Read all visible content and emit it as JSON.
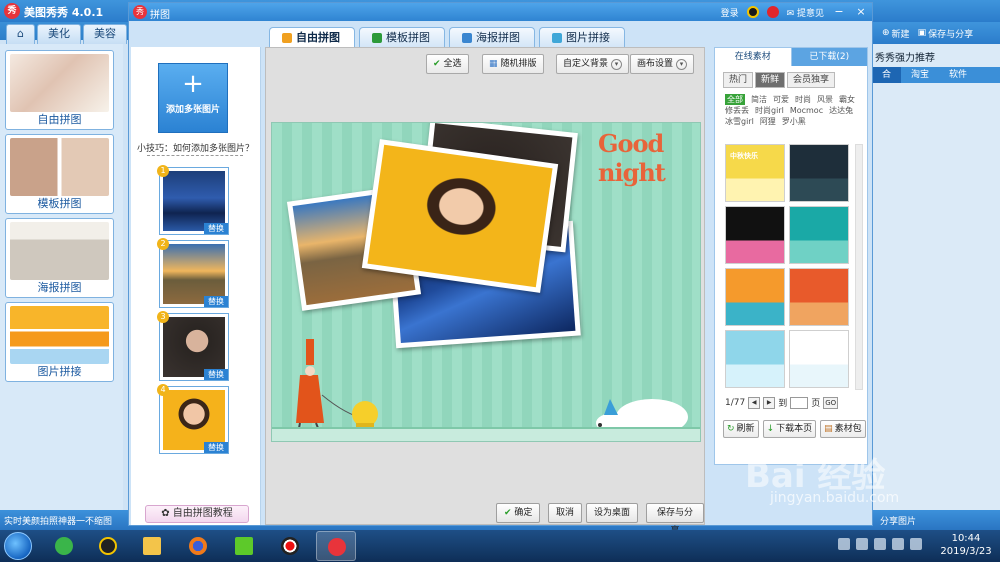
{
  "bg_app": {
    "title": "美图秀秀 4.0.1",
    "tabs": [
      "美化",
      "美容"
    ],
    "sidebar": [
      "自由拼图",
      "模板拼图",
      "海报拼图",
      "图片拼接"
    ],
    "right_buttons": {
      "new": "新建",
      "save_share": "保存与分享"
    },
    "right_heading": "秀秀强力推荐",
    "right_tabs": [
      "合",
      "淘宝",
      "软件"
    ],
    "status_text": "实时美颜拍照神器一不缩图",
    "share_photo": "分享图片"
  },
  "dialog": {
    "title": "拼图",
    "login": "登录",
    "feedback": "提意见",
    "min": "−",
    "close": "×",
    "tabs": [
      {
        "label": "自由拼图",
        "active": true
      },
      {
        "label": "模板拼图",
        "active": false
      },
      {
        "label": "海报拼图",
        "active": false
      },
      {
        "label": "图片拼接",
        "active": false
      }
    ]
  },
  "left_panel": {
    "add_button": "添加多张图片",
    "tip": "小技巧：如何添加多张图片？",
    "photos": [
      {
        "num": "1",
        "replace": "替换"
      },
      {
        "num": "2",
        "replace": "替换"
      },
      {
        "num": "3",
        "replace": "替换"
      },
      {
        "num": "4",
        "replace": "替换"
      }
    ],
    "tutorial": "自由拼图教程"
  },
  "toolbar": {
    "select_all": "全选",
    "random": "随机排版",
    "custom_bg": "自定义背景",
    "canvas_settings": "画布设置"
  },
  "collage": {
    "caption": "Good night"
  },
  "bottom_buttons": {
    "confirm": "确定",
    "cancel": "取消",
    "set_wallpaper": "设为桌面",
    "save_share": "保存与分享"
  },
  "materials": {
    "tabs": [
      "在线素材",
      "已下载(2)"
    ],
    "subtabs": [
      {
        "label": "热门",
        "active": false
      },
      {
        "label": "新鲜",
        "active": true
      },
      {
        "label": "会员独享",
        "active": false
      }
    ],
    "tags": [
      {
        "label": "全部",
        "active": true
      },
      {
        "label": "简洁",
        "active": false
      },
      {
        "label": "可爱",
        "active": false
      },
      {
        "label": "时尚",
        "active": false
      },
      {
        "label": "风景",
        "active": false
      },
      {
        "label": "霸女",
        "active": false
      },
      {
        "label": "修丢丢",
        "active": false
      },
      {
        "label": "时尚girl",
        "active": false
      },
      {
        "label": "Mocmoc",
        "active": false
      },
      {
        "label": "达达兔",
        "active": false
      },
      {
        "label": "冰雪girl",
        "active": false
      },
      {
        "label": "阿狸",
        "active": false
      },
      {
        "label": "罗小黑",
        "active": false
      }
    ],
    "templates": [
      {
        "colors": [
          "#f6d94a",
          "#fff3b0"
        ],
        "label": "中秋快乐"
      },
      {
        "colors": [
          "#1e2e3a",
          "#2d4a55"
        ],
        "label": ""
      },
      {
        "colors": [
          "#111111",
          "#e86aa0"
        ],
        "label": ""
      },
      {
        "colors": [
          "#1aa9a6",
          "#6fd1c5"
        ],
        "label": ""
      },
      {
        "colors": [
          "#f59a2c",
          "#3bb3c8"
        ],
        "label": ""
      },
      {
        "colors": [
          "#e85a2b",
          "#f0a460"
        ],
        "label": ""
      },
      {
        "colors": [
          "#8fd6ea",
          "#d6f2fb"
        ],
        "label": ""
      },
      {
        "colors": [
          "#ffffff",
          "#e8f6fb"
        ],
        "label": ""
      }
    ],
    "pager": {
      "page": "1/77",
      "to": "到",
      "unit": "页",
      "go": "GO"
    },
    "actions": {
      "refresh": "刷新",
      "download_page": "下载本页",
      "material_pack": "素材包"
    }
  },
  "taskbar": {
    "time": "10:44",
    "date": "2019/3/23"
  },
  "watermark": {
    "main": "Bai 经验",
    "sub": "jingyan.baidu.com"
  }
}
